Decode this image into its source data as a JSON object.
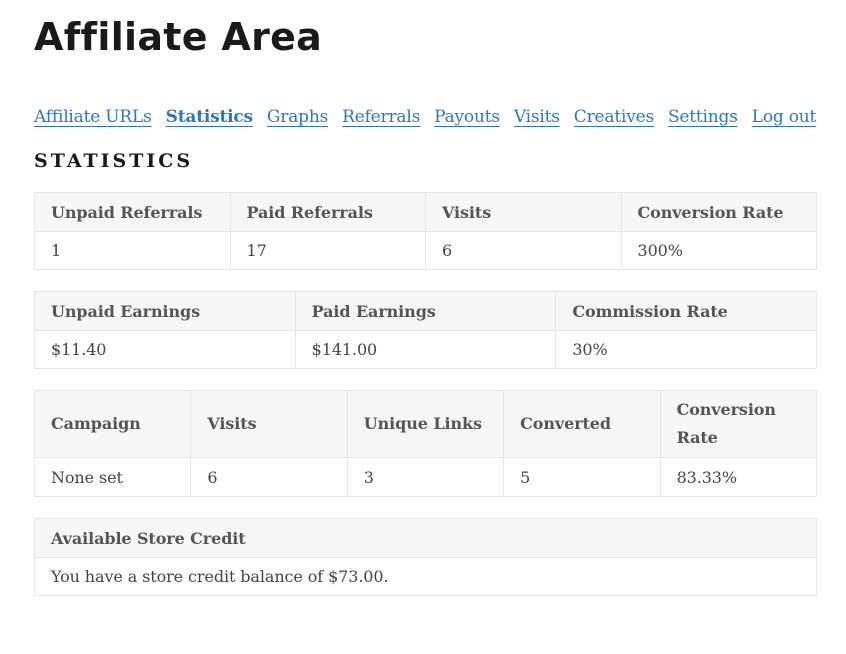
{
  "page": {
    "title": "Affiliate Area"
  },
  "nav": {
    "tabs": [
      {
        "label": "Affiliate URLs",
        "active": false
      },
      {
        "label": "Statistics",
        "active": true
      },
      {
        "label": "Graphs",
        "active": false
      },
      {
        "label": "Referrals",
        "active": false
      },
      {
        "label": "Payouts",
        "active": false
      },
      {
        "label": "Visits",
        "active": false
      },
      {
        "label": "Creatives",
        "active": false
      },
      {
        "label": "Settings",
        "active": false
      },
      {
        "label": "Log out",
        "active": false
      }
    ],
    "link_color": "#2e78b7"
  },
  "section": {
    "heading": "Statistics"
  },
  "referrals_table": {
    "headers": [
      "Unpaid Referrals",
      "Paid Referrals",
      "Visits",
      "Conversion Rate"
    ],
    "row": [
      "1",
      "17",
      "6",
      "300%"
    ]
  },
  "earnings_table": {
    "headers": [
      "Unpaid Earnings",
      "Paid Earnings",
      "Commission Rate"
    ],
    "row": [
      "$11.40",
      "$141.00",
      "30%"
    ]
  },
  "campaign_table": {
    "headers": [
      "Campaign",
      "Visits",
      "Unique Links",
      "Converted",
      "Conversion Rate"
    ],
    "row": [
      "None set",
      "6",
      "3",
      "5",
      "83.33%"
    ]
  },
  "store_credit_table": {
    "header": "Available Store Credit",
    "row": "You have a store credit balance of $73.00."
  }
}
